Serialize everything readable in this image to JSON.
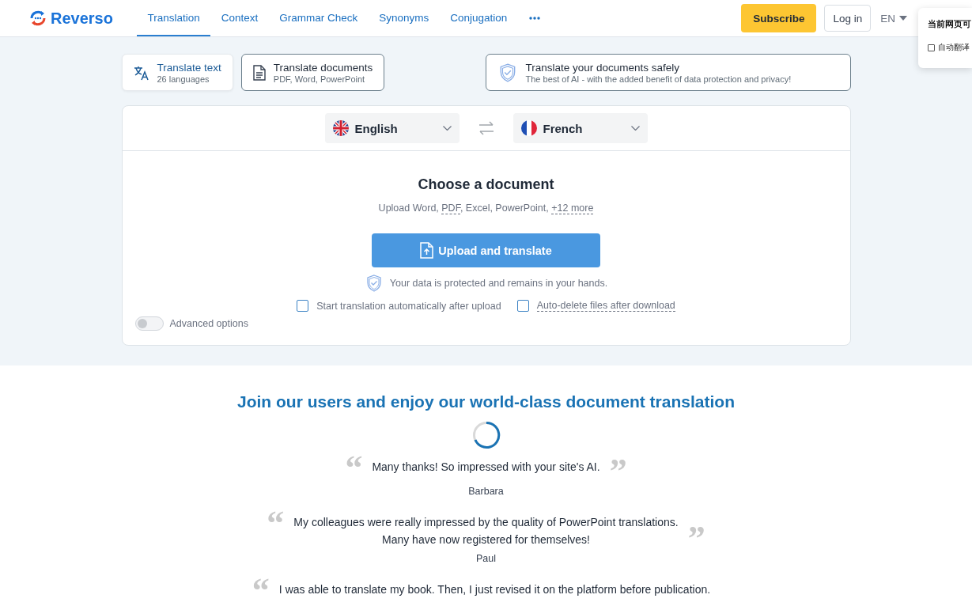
{
  "header": {
    "logo": "Reverso",
    "nav": [
      {
        "label": "Translation",
        "selected": true
      },
      {
        "label": "Context",
        "selected": false
      },
      {
        "label": "Grammar Check",
        "selected": false
      },
      {
        "label": "Synonyms",
        "selected": false
      },
      {
        "label": "Conjugation",
        "selected": false
      }
    ],
    "subscribe": "Subscribe",
    "login": "Log in",
    "language": "EN"
  },
  "modes": [
    {
      "kind": "text",
      "title": "Translate text",
      "subtitle": "26 languages",
      "selected": false
    },
    {
      "kind": "document",
      "title": "Translate documents",
      "subtitle": "PDF, Word, PowerPoint",
      "selected": true
    }
  ],
  "promo": {
    "title": "Translate your documents safely",
    "subtitle": "The best of AI - with the added benefit of data protection and privacy!"
  },
  "languages": {
    "source": {
      "kind": "uk",
      "name": "English"
    },
    "target": {
      "kind": "fr",
      "name": "French"
    }
  },
  "upload": {
    "title": "Choose a document",
    "formats": [
      {
        "kind": "plain",
        "text": "Upload Word, "
      },
      {
        "kind": "hint",
        "text": "PDF"
      },
      {
        "kind": "plain",
        "text": ", Excel, PowerPoint, "
      },
      {
        "kind": "hint",
        "text": "+12 more"
      }
    ],
    "button": "Upload and translate",
    "privacy": "Your data is protected and remains in your hands."
  },
  "options": [
    {
      "kind": "plain",
      "label": "Start translation automatically after upload",
      "checked": false
    },
    {
      "kind": "hint",
      "label": "Auto-delete files after download",
      "checked": false
    }
  ],
  "advanced": {
    "label": "Advanced options",
    "on": false
  },
  "testimonials": {
    "heading": "Join our users and enjoy our world-class document translation",
    "items": [
      {
        "open_mark": "“",
        "text": "Many thanks! So impressed with your site's AI.",
        "close_mark": "”",
        "author": "Barbara"
      },
      {
        "open_mark": "“",
        "text": "My colleagues were really impressed by the quality of PowerPoint translations.\nMany have now registered for themselves!",
        "close_mark": "”",
        "author": "Paul"
      },
      {
        "open_mark": "“",
        "text": "I was able to translate my book. Then, I just revised it on the platform before publication."
      }
    ]
  },
  "popup": {
    "title": "当前网页可",
    "option": {
      "label": "自动翻译",
      "checked": false
    }
  }
}
